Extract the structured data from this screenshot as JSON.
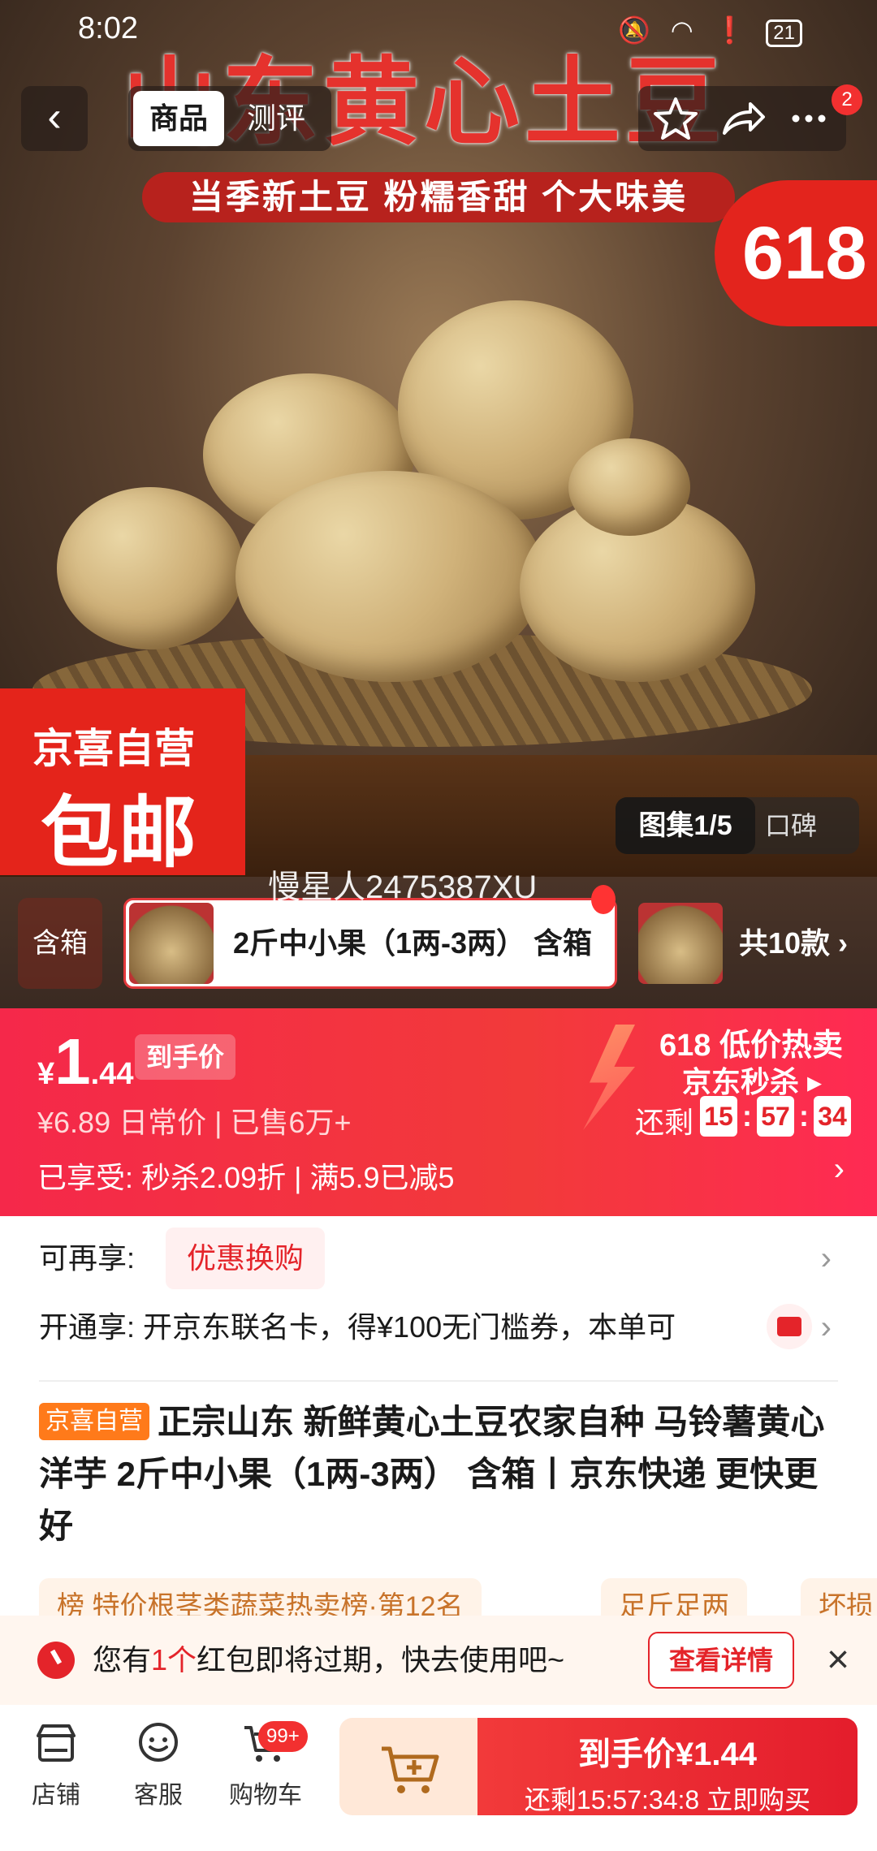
{
  "status_bar": {
    "time": "8:02",
    "battery": "21"
  },
  "nav": {
    "tabs": [
      {
        "label": "商品",
        "active": true
      },
      {
        "label": "测评",
        "active": false
      }
    ],
    "more_badge": "2"
  },
  "hero": {
    "title": "山东黄心土豆",
    "subtitle": "当季新土豆 粉糯香甜 个大味美",
    "badge_618": "618",
    "promo_line1": "京喜自营",
    "promo_line2": "包邮",
    "gallery_label": "图集1/5",
    "reviews_label": "口碑"
  },
  "watermark": "慢星人2475387XU",
  "variants": {
    "left_label": "含箱",
    "selected": "2斤中小果（1两-3两） 含箱",
    "total": "共10款"
  },
  "price": {
    "currency": "¥",
    "integer": "1",
    "decimal": ".44",
    "tag": "到手价",
    "original": "¥6.89",
    "original_label": "日常价",
    "sold": "已售6万+",
    "promo_label": "已享受:",
    "promo_1": "秒杀2.09折",
    "promo_2": "满5.9已减5",
    "hot_sale": "618 低价热卖",
    "seckill": "京东秒杀",
    "remaining": "还剩",
    "countdown": {
      "h": "15",
      "m": "57",
      "s": "34"
    }
  },
  "extra_offer": {
    "label": "可再享:",
    "tag": "优惠换购"
  },
  "card_offer": {
    "label": "开通享:",
    "text": "开京东联名卡，得¥100无门槛券，本单可"
  },
  "product": {
    "store_tag": "京喜自营",
    "title": "正宗山东 新鲜黄心土豆农家自种 马铃薯黄心洋芋 2斤中小果（1两-3两） 含箱丨京东快递 更快更好"
  },
  "chips": [
    "榜 特价根茎类蔬菜热卖榜·第12名",
    "足斤足两",
    "坏损"
  ],
  "notice": {
    "pre": "您有",
    "count": "1个",
    "post": "红包即将过期，快去使用吧~",
    "button": "查看详情"
  },
  "bottom_bar": {
    "store": "店铺",
    "service": "客服",
    "cart": "购物车",
    "cart_badge": "99+",
    "buy_title": "到手价¥1.44",
    "buy_sub": "还剩15:57:34:8 立即购买"
  },
  "colors": {
    "accent": "#e4242a",
    "promo_orange": "#ff7a1a"
  }
}
